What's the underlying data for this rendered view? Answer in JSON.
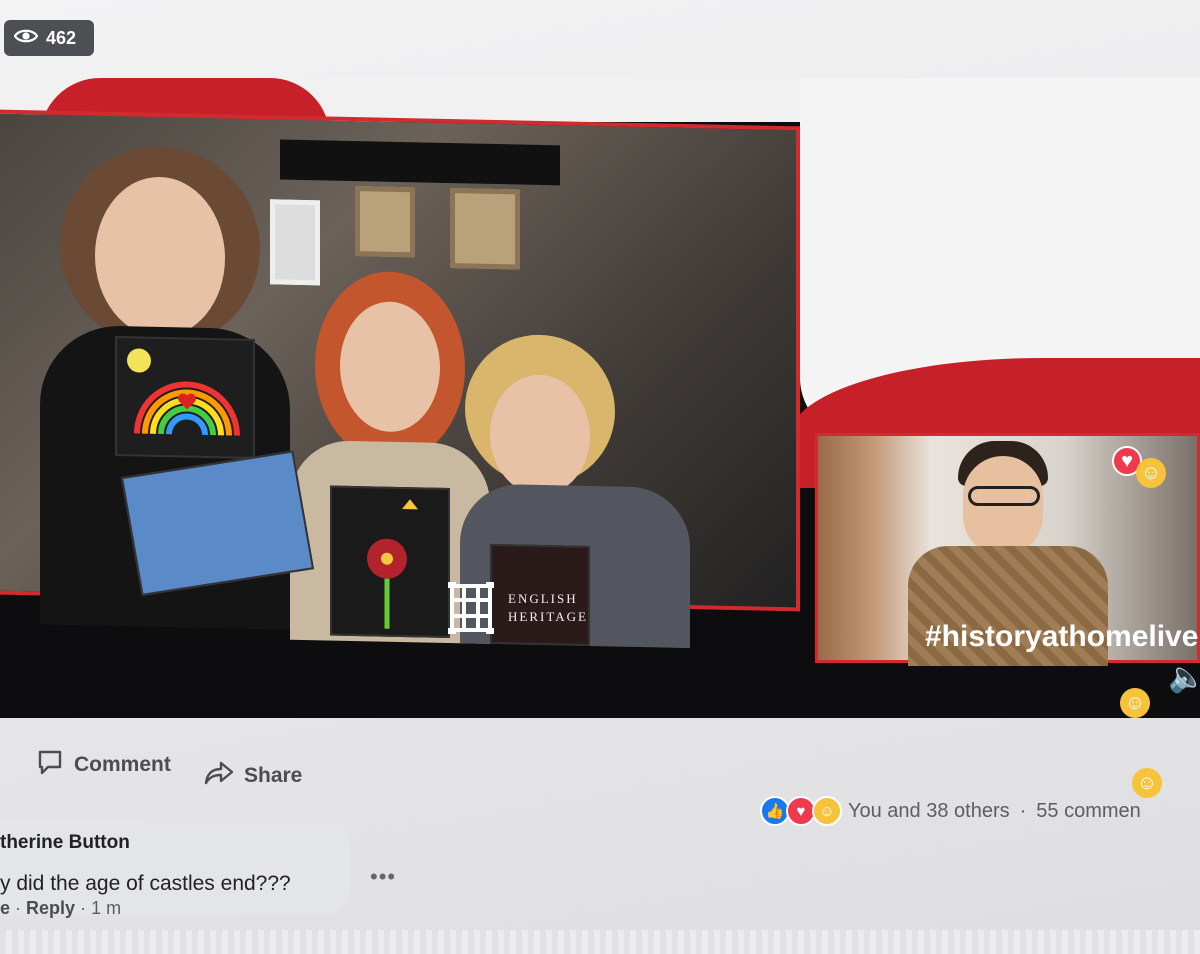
{
  "views": {
    "count": "462",
    "icon": "eye-icon"
  },
  "video": {
    "logo_line1": "ENGLISH",
    "logo_line2": "HERITAGE",
    "hashtag": "#historyathomelive",
    "brand_red": "#c62128"
  },
  "actions": {
    "comment_label": "Comment",
    "share_label": "Share"
  },
  "reactions": {
    "icons": [
      "like-icon",
      "love-icon",
      "care-icon"
    ],
    "summary": "You and 38 others",
    "separator": "·",
    "comments_count": "55 commen"
  },
  "comment": {
    "author": "therine Button",
    "text": "y did the age of castles end???",
    "more": "•••",
    "like_fragment": "e",
    "dot": "·",
    "reply_label": "Reply",
    "time": "1 m"
  }
}
